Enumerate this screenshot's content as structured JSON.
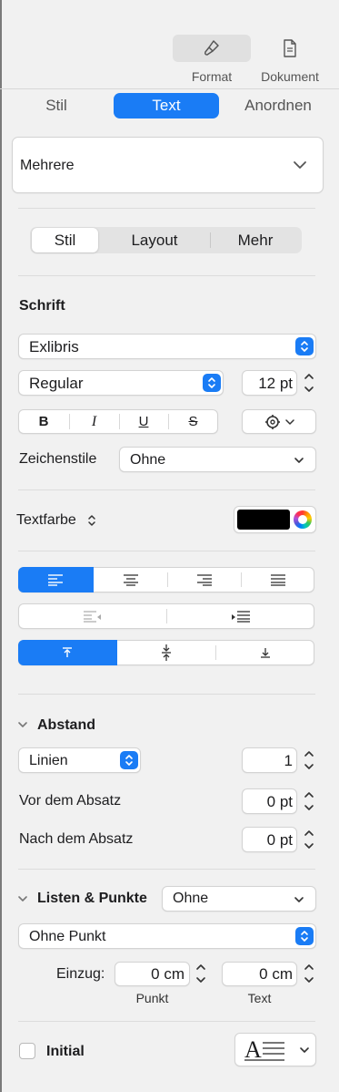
{
  "toolbar": {
    "format_label": "Format",
    "document_label": "Dokument",
    "format_icon": "paintbrush-icon",
    "document_icon": "document-icon"
  },
  "tabs": [
    "Stil",
    "Text",
    "Anordnen"
  ],
  "paragraph_style": {
    "value": "Mehrere"
  },
  "subtabs": [
    "Stil",
    "Layout",
    "Mehr"
  ],
  "font": {
    "section_title": "Schrift",
    "family": "Exlibris",
    "typeface": "Regular",
    "size": "12 pt",
    "bold": "B",
    "italic": "I",
    "underline": "U",
    "strike": "S"
  },
  "char_styles": {
    "label": "Zeichenstile",
    "value": "Ohne"
  },
  "text_color": {
    "label": "Textfarbe",
    "swatch": "#000000"
  },
  "spacing": {
    "title": "Abstand",
    "mode": "Linien",
    "line_value": "1",
    "before_label": "Vor dem Absatz",
    "before_value": "0 pt",
    "after_label": "Nach dem Absatz",
    "after_value": "0 pt"
  },
  "lists": {
    "title": "Listen & Punkte",
    "value": "Ohne",
    "bullet_style": "Ohne Punkt",
    "indent_label": "Einzug:",
    "bullet_indent": "0 cm",
    "text_indent": "0 cm",
    "bullet_caption": "Punkt",
    "text_caption": "Text"
  },
  "dropcap": {
    "label": "Initial",
    "preview_letter": "A"
  },
  "colors": {
    "accent": "#1a7cf5"
  }
}
